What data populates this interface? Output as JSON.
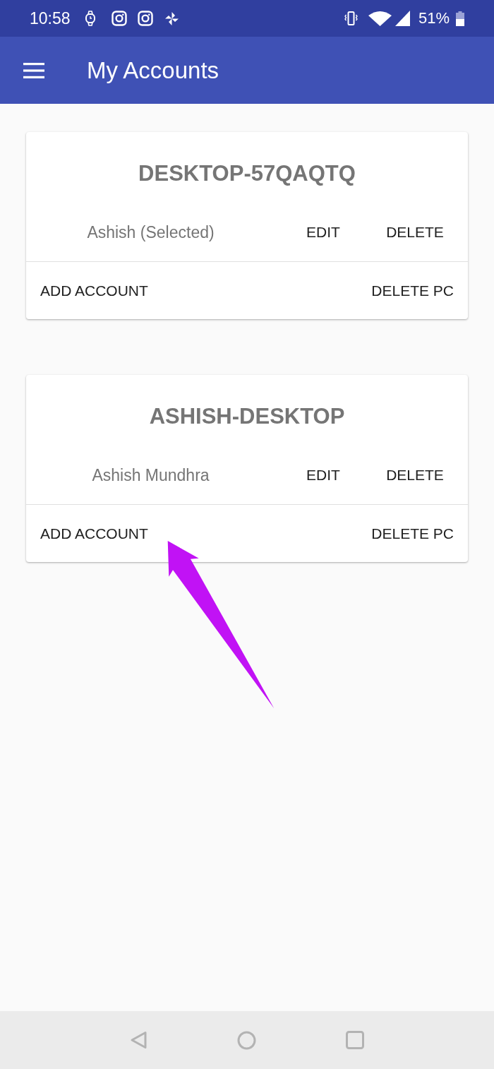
{
  "status_bar": {
    "time": "10:58",
    "battery": "51%"
  },
  "app_bar": {
    "title": "My Accounts"
  },
  "pcs": [
    {
      "name": "DESKTOP-57QAQTQ",
      "accounts": [
        {
          "name": "Ashish (Selected)",
          "edit": "EDIT",
          "delete": "DELETE"
        }
      ],
      "add_account": "ADD ACCOUNT",
      "delete_pc": "DELETE PC",
      "arrow_pointer": false
    },
    {
      "name": "ASHISH-DESKTOP",
      "accounts": [
        {
          "name": "Ashish Mundhra",
          "edit": "EDIT",
          "delete": "DELETE"
        }
      ],
      "add_account": "ADD ACCOUNT",
      "delete_pc": "DELETE PC",
      "arrow_pointer": true
    }
  ]
}
